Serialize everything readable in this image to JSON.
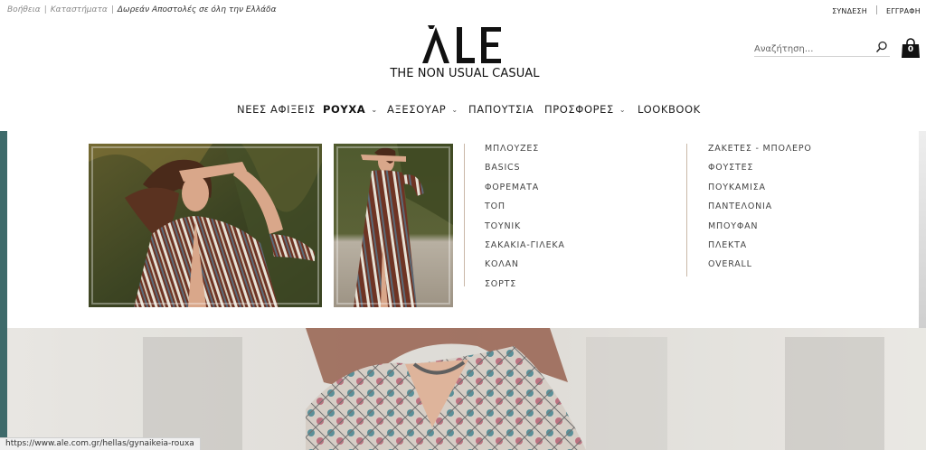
{
  "topbar": {
    "help": "Βοήθεια",
    "stores": "Καταστήματα",
    "shipping": "Δωρεάν Αποστολές σε όλη την Ελλάδα",
    "login": "ΣΥΝΔΕΣΗ",
    "register": "ΕΓΓΡΑΦΗ"
  },
  "logo": {
    "wordmark": "ALE",
    "tagline": "THE NON USUAL CASUAL"
  },
  "search": {
    "placeholder": "Αναζήτηση..."
  },
  "cart": {
    "count": "0"
  },
  "nav": {
    "items": [
      {
        "label": "ΝΕΕΣ ΑΦΙΞΕΙΣ"
      },
      {
        "label": "ΡΟΥΧΑ"
      },
      {
        "label": "ΑΞΕΣΟΥΑΡ"
      },
      {
        "label": "ΠΑΠΟΥΤΣΙΑ"
      },
      {
        "label": "ΠΡΟΣΦΟΡΕΣ"
      },
      {
        "label": "LOOKBOOK"
      }
    ],
    "active": "ΡΟΥΧΑ"
  },
  "mega": {
    "col1": [
      "ΜΠΛΟΥΖΕΣ",
      "BASICS",
      "ΦΟΡΕΜΑΤΑ",
      "ΤΟΠ",
      "ΤΟΥΝΙΚ",
      "ΣΑΚΑΚΙΑ-ΓΙΛΕΚΑ",
      "ΚΟΛΑΝ",
      "ΣΟΡΤΣ"
    ],
    "col2": [
      "ΖΑΚΕΤΕΣ - ΜΠΟΛΕΡΟ",
      "ΦΟΥΣΤΕΣ",
      "ΠΟΥΚΑΜΙΣΑ",
      "ΠΑΝΤΕΛΟΝΙΑ",
      "ΜΠΟΥΦΑΝ",
      "ΠΛΕΚΤΑ",
      "OVERALL"
    ]
  },
  "statusbar": {
    "url": "https://www.ale.com.gr/hellas/gynaikeia-rouxa"
  },
  "colors": {
    "accent_line": "#c9b8a8",
    "text": "#222222"
  }
}
